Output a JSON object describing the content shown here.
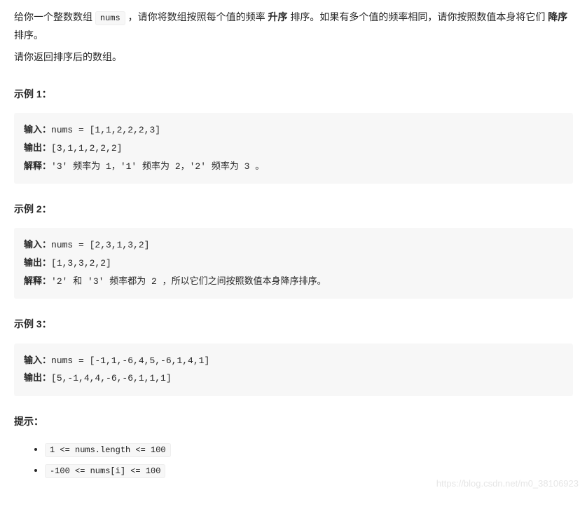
{
  "intro": {
    "p1_a": "给你一个整数数组 ",
    "p1_code": "nums",
    "p1_b": " ，请你将数组按照每个值的频率 ",
    "p1_bold1": "升序",
    "p1_c": " 排序。如果有多个值的频率相同，请你按照数值本身将它们 ",
    "p1_bold2": "降序",
    "p1_d": " 排序。",
    "p2": "请你返回排序后的数组。"
  },
  "labels": {
    "input": "输入：",
    "output": "输出：",
    "explain": "解释："
  },
  "examples": [
    {
      "heading": "示例 1：",
      "input": "nums = [1,1,2,2,2,3]",
      "output": "[3,1,1,2,2,2]",
      "explain": "'3' 频率为 1，'1' 频率为 2，'2' 频率为 3 。"
    },
    {
      "heading": "示例 2：",
      "input": "nums = [2,3,1,3,2]",
      "output": "[1,3,3,2,2]",
      "explain": "'2' 和 '3' 频率都为 2 ，所以它们之间按照数值本身降序排序。"
    },
    {
      "heading": "示例 3：",
      "input": "nums = [-1,1,-6,4,5,-6,1,4,1]",
      "output": "[5,-1,4,4,-6,-6,1,1,1]",
      "explain": ""
    }
  ],
  "hints": {
    "heading": "提示：",
    "items": [
      "1 <= nums.length <= 100",
      "-100 <= nums[i] <= 100"
    ]
  },
  "watermark": "https://blog.csdn.net/m0_38106923"
}
